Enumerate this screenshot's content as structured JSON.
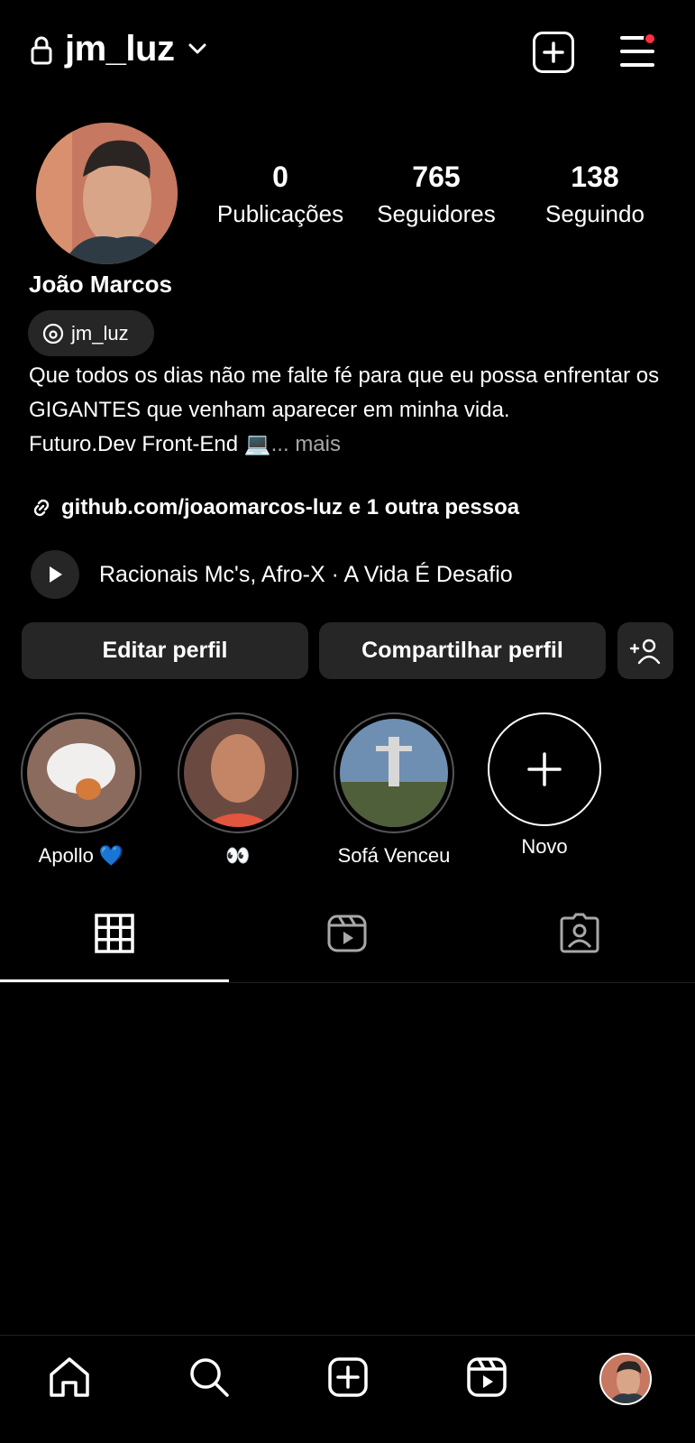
{
  "header": {
    "username": "jm_luz",
    "icons": [
      "lock-icon",
      "chevron-down-icon",
      "create-post-icon",
      "menu-icon"
    ],
    "notification_color": "#ff3040"
  },
  "profile": {
    "full_name": "João Marcos",
    "threads_handle": "jm_luz",
    "stats": [
      {
        "value": "0",
        "label": "Publicações"
      },
      {
        "value": "765",
        "label": "Seguidores"
      },
      {
        "value": "138",
        "label": "Seguindo"
      }
    ],
    "bio_lines": [
      "Que todos os dias não me falte fé para que eu possa enfrentar os GIGANTES que venham aparecer em minha vida.",
      "Futuro.Dev Front-End 💻"
    ],
    "bio_more": "... mais",
    "link_text": "github.com/joaomarcos-luz e 1 outra pessoa",
    "music": "Racionais Mc's, Afro-X · A Vida É Desafio"
  },
  "actions": {
    "edit": "Editar perfil",
    "share": "Compartilhar perfil"
  },
  "highlights": [
    {
      "label": "Apollo 💙"
    },
    {
      "label": "👀"
    },
    {
      "label": "Sofá Venceu"
    },
    {
      "label": "Novo"
    }
  ],
  "tabs": [
    "grid-icon",
    "reels-icon",
    "tagged-icon"
  ],
  "nav": [
    "home-icon",
    "search-icon",
    "create-icon",
    "reels-icon",
    "profile-avatar"
  ]
}
